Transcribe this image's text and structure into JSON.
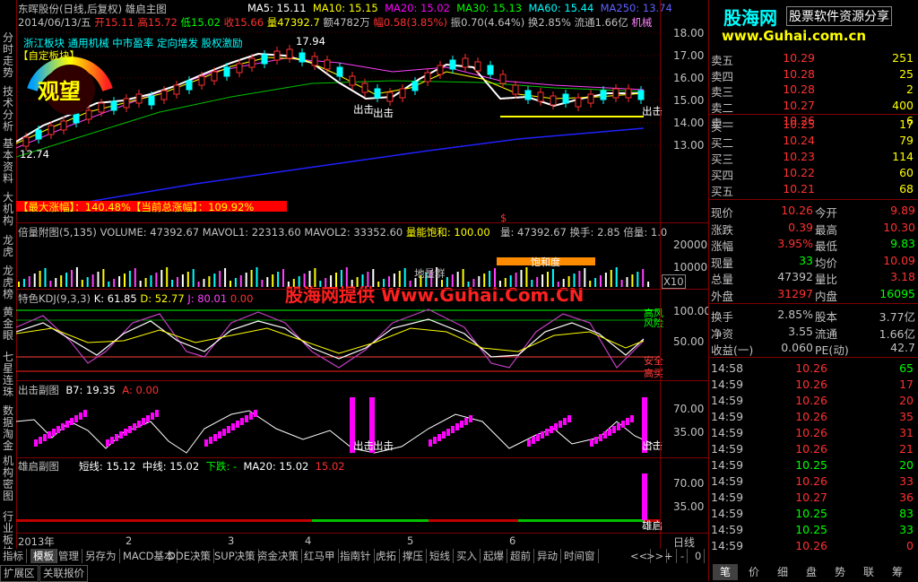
{
  "left_tabs": [
    "分时走势",
    "技术分析",
    "基本资料",
    "大机构",
    "龙虎",
    "龙虎榜",
    "黄金眼",
    "七星连珠",
    "数据淘金",
    "机构密图",
    "行业板块"
  ],
  "main": {
    "title": "东晖股份(日线,后复权) 雄启主图",
    "ma_labels": [
      "MA5: 15.11",
      "MA10: 15.15",
      "MA20: 15.02",
      "MA30: 15.13",
      "MA60: 15.44",
      "MA250: 13.74"
    ],
    "ma_colors": [
      "#ffffff",
      "#ffff00",
      "#ff00ff",
      "#00ff00",
      "#00ffff",
      "#4040ff"
    ],
    "info_line": {
      "date": "2014/06/13/五",
      "open": "开15.11",
      "high": "高15.72",
      "low": "低15.02",
      "close": "收15.66",
      "vol": "量47392.7",
      "amt": "额4782万",
      "chg": "幅0.58(3.85%)",
      "amp": "振0.70(4.64%)",
      "turn": "换2.85%",
      "float": "流通1.66亿",
      "sector": "机械"
    },
    "tags_line": "浙江板块 通用机械 中市盈率 定向增发 股权激励",
    "custom_block": "【自定板块】",
    "watch_label": "观望",
    "price_max": "17.94",
    "price_min": "12.74",
    "signal_labels": [
      "出击",
      "出击",
      "出击"
    ],
    "gain_line": "【最大涨幅】：140.48%【当前总涨幅】：109.92%",
    "dollar": "$"
  },
  "vol": {
    "title": "倍量附图(5,135)",
    "values": "VOLUME: 47392.67   MAVOL1: 22313.60   MAVOL2: 33352.60",
    "sat": "量能饱和: 100.00",
    "right": "量: 47392.67  换手: 2.85  倍量: 1.0",
    "sat_box": "饱和度",
    "group": "地量群",
    "x10": "X10"
  },
  "kdj": {
    "title": "特色KDJ(9,3,3)",
    "k": "K: 61.85",
    "d": "D: 52.77",
    "j": "J: 80.01",
    "extra": "0.00",
    "labels_right": [
      "高风",
      "风险",
      "安全",
      "高买"
    ],
    "watermark": "股海网提供 Www.Guhai.Com.CN"
  },
  "attack": {
    "title": "出击副图",
    "b7": "B7: 19.35",
    "a": "A: 0.00",
    "signal_labels": [
      "出击",
      "出击",
      "出击"
    ]
  },
  "launch": {
    "title": "雄启副图",
    "short": "短线: 15.12",
    "mid": "中线: 15.02",
    "down": "下跌: -",
    "ma20": "MA20: 15.02",
    "v": "15.02",
    "end_label": "雄启"
  },
  "yaxis": {
    "main": [
      "18.00",
      "17.00",
      "16.00",
      "15.00",
      "14.00",
      "13.00"
    ],
    "vol": [
      "20000",
      "10000"
    ],
    "kdj": [
      "100.00",
      "50.00"
    ],
    "attack": [
      "70.00",
      "35.00"
    ],
    "launch": [
      "70.00",
      "35.00"
    ],
    "period": "日线"
  },
  "xaxis": [
    "2013年",
    "2",
    "3",
    "4",
    "5",
    "6"
  ],
  "bottom_tabs": [
    "指标",
    "模板",
    "管理",
    "另存为",
    "MACD基本",
    "DDE决策",
    "SUP决策",
    "资金决策",
    "红马甲",
    "指南针",
    "虎拓",
    "撑压",
    "短线",
    "买入",
    "起爆",
    "超前",
    "异动",
    "时间窗"
  ],
  "bottom_tabs2": [
    "扩展区",
    "关联报价"
  ],
  "nav_arrows": [
    "<<",
    ">>",
    "+",
    "-",
    "0"
  ],
  "right_panel": {
    "logo": "股海网",
    "logo_right": "股票软件资源分享",
    "url": "www.Guhai.com.cn",
    "sells": [
      {
        "label": "卖五",
        "price": "10.29",
        "vol": "251"
      },
      {
        "label": "卖四",
        "price": "10.28",
        "vol": "25"
      },
      {
        "label": "卖三",
        "price": "10.28",
        "vol": "2"
      },
      {
        "label": "卖二",
        "price": "10.27",
        "vol": "400"
      },
      {
        "label": "卖一",
        "price": "10.26",
        "vol": "6"
      }
    ],
    "buys": [
      {
        "label": "买一",
        "price": "10.25",
        "vol": "17"
      },
      {
        "label": "买二",
        "price": "10.24",
        "vol": "79"
      },
      {
        "label": "买三",
        "price": "10.23",
        "vol": "114"
      },
      {
        "label": "买四",
        "price": "10.22",
        "vol": "60"
      },
      {
        "label": "买五",
        "price": "10.21",
        "vol": "68"
      }
    ],
    "stats": [
      {
        "l1": "现价",
        "v1": "10.26",
        "l2": "今开",
        "v2": "9.89",
        "c1": "#ff3030",
        "c2": "#ff3030"
      },
      {
        "l1": "涨跌",
        "v1": "0.39",
        "l2": "最高",
        "v2": "10.30",
        "c1": "#ff3030",
        "c2": "#ff3030"
      },
      {
        "l1": "涨幅",
        "v1": "3.95%",
        "l2": "最低",
        "v2": "9.83",
        "c1": "#ff3030",
        "c2": "#00ff00"
      },
      {
        "l1": "现量",
        "v1": "33",
        "l2": "均价",
        "v2": "10.09",
        "c1": "#00ff00",
        "c2": "#ff3030"
      },
      {
        "l1": "总量",
        "v1": "47392",
        "l2": "量比",
        "v2": "3.18",
        "c1": "#c0c0c0",
        "c2": "#ff3030"
      },
      {
        "l1": "外盘",
        "v1": "31297",
        "l2": "内盘",
        "v2": "16095",
        "c1": "#ff3030",
        "c2": "#00ff00"
      }
    ],
    "stats2": [
      {
        "l1": "换手",
        "v1": "2.85%",
        "l2": "股本",
        "v2": "3.77亿",
        "c1": "#c0c0c0",
        "c2": "#c0c0c0"
      },
      {
        "l1": "净资",
        "v1": "3.55",
        "l2": "流通",
        "v2": "1.66亿",
        "c1": "#c0c0c0",
        "c2": "#c0c0c0"
      },
      {
        "l1": "收益(一)",
        "v1": "0.060",
        "l2": "PE(动)",
        "v2": "42.7",
        "c1": "#c0c0c0",
        "c2": "#c0c0c0"
      }
    ],
    "ticks": [
      {
        "t": "14:58",
        "p": "10.26",
        "v": "65",
        "c": "#00ff00"
      },
      {
        "t": "14:59",
        "p": "10.26",
        "v": "17",
        "c": "#ff3030"
      },
      {
        "t": "14:59",
        "p": "10.26",
        "v": "20",
        "c": "#ff3030"
      },
      {
        "t": "14:59",
        "p": "10.26",
        "v": "35",
        "c": "#ff3030"
      },
      {
        "t": "14:59",
        "p": "10.26",
        "v": "31",
        "c": "#ff3030"
      },
      {
        "t": "14:59",
        "p": "10.26",
        "v": "21",
        "c": "#ff3030"
      },
      {
        "t": "14:59",
        "p": "10.25",
        "v": "20",
        "c": "#00ff00"
      },
      {
        "t": "14:59",
        "p": "10.26",
        "v": "33",
        "c": "#ff3030"
      },
      {
        "t": "14:59",
        "p": "10.27",
        "v": "36",
        "c": "#ff3030"
      },
      {
        "t": "14:59",
        "p": "10.25",
        "v": "83",
        "c": "#00ff00"
      },
      {
        "t": "14:59",
        "p": "10.25",
        "v": "33",
        "c": "#00ff00"
      },
      {
        "t": "14:59",
        "p": "10.26",
        "v": "0",
        "c": "#ff3030"
      }
    ],
    "bottom_tabs": [
      "笔",
      "价",
      "细",
      "盘",
      "势",
      "联",
      "筹"
    ]
  }
}
